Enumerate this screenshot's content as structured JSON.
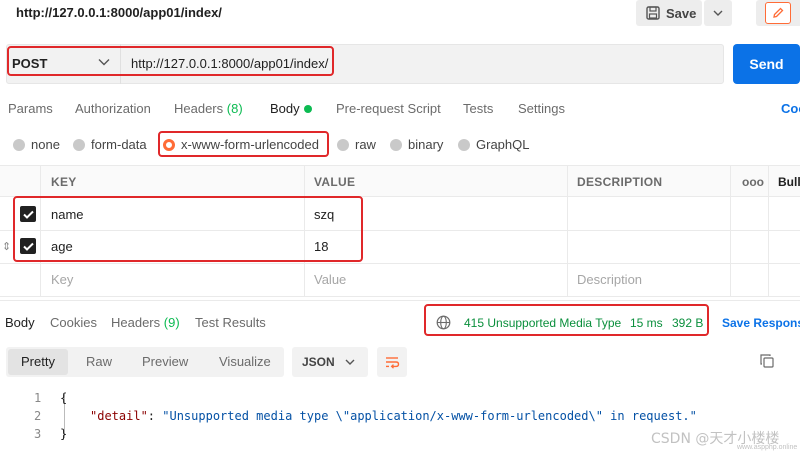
{
  "header": {
    "title": "http://127.0.0.1:8000/app01/index/",
    "save_label": "Save"
  },
  "request": {
    "method": "POST",
    "url": "http://127.0.0.1:8000/app01/index/",
    "send_label": "Send"
  },
  "tabs": {
    "params": "Params",
    "authorization": "Authorization",
    "headers": "Headers",
    "headers_count": "(8)",
    "body": "Body",
    "prerequest": "Pre-request Script",
    "tests": "Tests",
    "settings": "Settings",
    "cookies": "Coo"
  },
  "body_types": {
    "none": "none",
    "form_data": "form-data",
    "urlencoded": "x-www-form-urlencoded",
    "raw": "raw",
    "binary": "binary",
    "graphql": "GraphQL"
  },
  "table": {
    "col_key": "KEY",
    "col_value": "VALUE",
    "col_description": "DESCRIPTION",
    "more": "ooo",
    "bulk": "Bull",
    "rows": [
      {
        "key": "name",
        "value": "szq"
      },
      {
        "key": "age",
        "value": "18"
      }
    ],
    "placeholder_key": "Key",
    "placeholder_value": "Value",
    "placeholder_description": "Description"
  },
  "response": {
    "tabs": {
      "body": "Body",
      "cookies": "Cookies",
      "headers": "Headers",
      "headers_count": "(9)",
      "test_results": "Test Results"
    },
    "status": "415 Unsupported Media Type",
    "time": "15 ms",
    "size": "392 B",
    "save_response": "Save Respons",
    "formats": {
      "pretty": "Pretty",
      "raw": "Raw",
      "preview": "Preview",
      "visualize": "Visualize",
      "type": "JSON"
    },
    "code": {
      "line1": "1",
      "line2": "2",
      "line3": "3",
      "open_brace": "{",
      "close_brace": "}",
      "key": "\"detail\"",
      "colon": ": ",
      "value": "\"Unsupported media type \\\"application/x-www-form-urlencoded\\\" in request.\""
    }
  },
  "watermark": "CSDN @天才小楼楼",
  "watermark_sub": "www.aspphp.online",
  "colors": {
    "accent": "#ff6c37",
    "send": "#0b72e7",
    "status_ok": "#0cbb52",
    "highlight": "#e0282a"
  }
}
